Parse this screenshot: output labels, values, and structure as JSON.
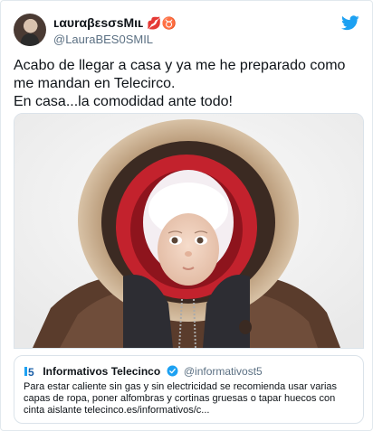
{
  "author": {
    "display_name": "ʟαυrαβεsσsMιʟ",
    "emoji": "💋♉",
    "handle": "@LauraBES0SMIL"
  },
  "tweet": {
    "text": "Acabo de llegar a casa y ya me he preparado como me mandan en Telecirco.\nEn casa...la comodidad ante todo!"
  },
  "quote": {
    "logo": "telecinco-5-logo",
    "name": "Informativos Telecinco",
    "handle": "@informativost5",
    "text": "Para estar caliente sin gas y sin electricidad se recomienda usar varias capas de ropa, poner alfombras y cortinas gruesas o tapar huecos con cinta aislante telecinco.es/informativos/c..."
  },
  "icons": {
    "brand": "twitter-bird-icon",
    "verified": "verified-badge-icon"
  },
  "colors": {
    "twitter_blue": "#1da1f2",
    "secondary_text": "#5b7083"
  }
}
